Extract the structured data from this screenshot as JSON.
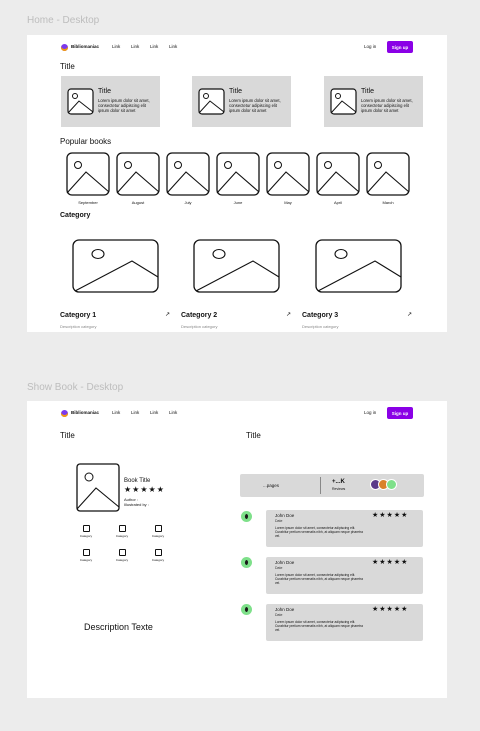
{
  "frames": {
    "home_label": "Home - Desktop",
    "show_label": "Show Book - Desktop"
  },
  "nav": {
    "brand": "Bibliomaniac",
    "links": [
      "Link",
      "Link",
      "Link",
      "Link"
    ],
    "login": "Log in",
    "signup": "Sign up"
  },
  "home": {
    "section_title": "Title",
    "cards": [
      {
        "title": "Title",
        "desc": "Lorem ipsum dolor sit amet, consectetur adipiscing elit ipsum dolor sit amet"
      },
      {
        "title": "Title",
        "desc": "Lorem ipsum dolor sit amet, consectetur adipiscing elit ipsum dolor sit amet"
      },
      {
        "title": "Title",
        "desc": "Lorem ipsum dolor sit amet, consectetur adipiscing elit ipsum dolor sit amet"
      }
    ],
    "popular_title": "Popular books",
    "months": [
      "September",
      "August",
      "July",
      "June",
      "May",
      "April",
      "March"
    ],
    "category_title": "Category",
    "categories": [
      {
        "name": "Category 1",
        "desc": "Description category"
      },
      {
        "name": "Category 2",
        "desc": "Description category"
      },
      {
        "name": "Category 3",
        "desc": "Description category"
      }
    ]
  },
  "show": {
    "left_title": "Title",
    "right_title": "Title",
    "book_title": "Book Title",
    "stars": "★★★★★",
    "author": "Author :",
    "illustrated": "Illustrated by :",
    "mini_categories": [
      "Category",
      "Category",
      "Category",
      "Category",
      "Category",
      "Category"
    ],
    "description": "Description Texte",
    "pages": "...pages",
    "reviews_count": "+...K",
    "reviews_label": "Reviews",
    "reviews": [
      {
        "name": "John Doe",
        "date": "Date",
        "text": "Lorem ipsum dolor sit amet, consectetur adipiscing elit. Curabitur pretium venenatis nibh, at aliquam neque pharetra vel.",
        "stars": "★★★★★"
      },
      {
        "name": "John Doe",
        "date": "Date",
        "text": "Lorem ipsum dolor sit amet, consectetur adipiscing elit. Curabitur pretium venenatis nibh, at aliquam neque pharetra vel.",
        "stars": "★★★★★"
      },
      {
        "name": "John Doe",
        "date": "Date",
        "text": "Lorem ipsum dolor sit amet, consectetur adipiscing elit. Curabitur pretium venenatis nibh, at aliquam neque pharetra vel.",
        "stars": "★★★★★"
      }
    ]
  },
  "colors": {
    "accent": "#8a00e6",
    "card_gray": "#d9d9d9",
    "avatar_green": "#7ee08a"
  }
}
